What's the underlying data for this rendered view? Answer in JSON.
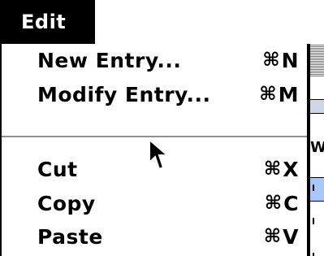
{
  "menubar": {
    "menu_title": "Edit"
  },
  "menu": {
    "items": [
      {
        "label": "New Entry...",
        "cmd_symbol": "⌘",
        "key": "N",
        "enabled": true
      },
      {
        "label": "Modify Entry...",
        "cmd_symbol": "⌘",
        "key": "M",
        "enabled": true
      },
      {
        "separator": true
      },
      {
        "label": "Cut",
        "cmd_symbol": "⌘",
        "key": "X",
        "enabled": true
      },
      {
        "label": "Copy",
        "cmd_symbol": "⌘",
        "key": "C",
        "enabled": true
      },
      {
        "label": "Paste",
        "cmd_symbol": "⌘",
        "key": "V",
        "enabled": true
      }
    ]
  },
  "background_window": {
    "visible_letter": "W"
  },
  "cursor": {
    "icon": "arrow-cursor-icon"
  },
  "colors": {
    "menu_title_bg": "#000000",
    "menu_title_fg": "#ffffff",
    "menu_bg": "#ffffff",
    "menu_text": "#000000",
    "separator": "#8f8f8f",
    "background_accent": "#a9c7ff"
  }
}
